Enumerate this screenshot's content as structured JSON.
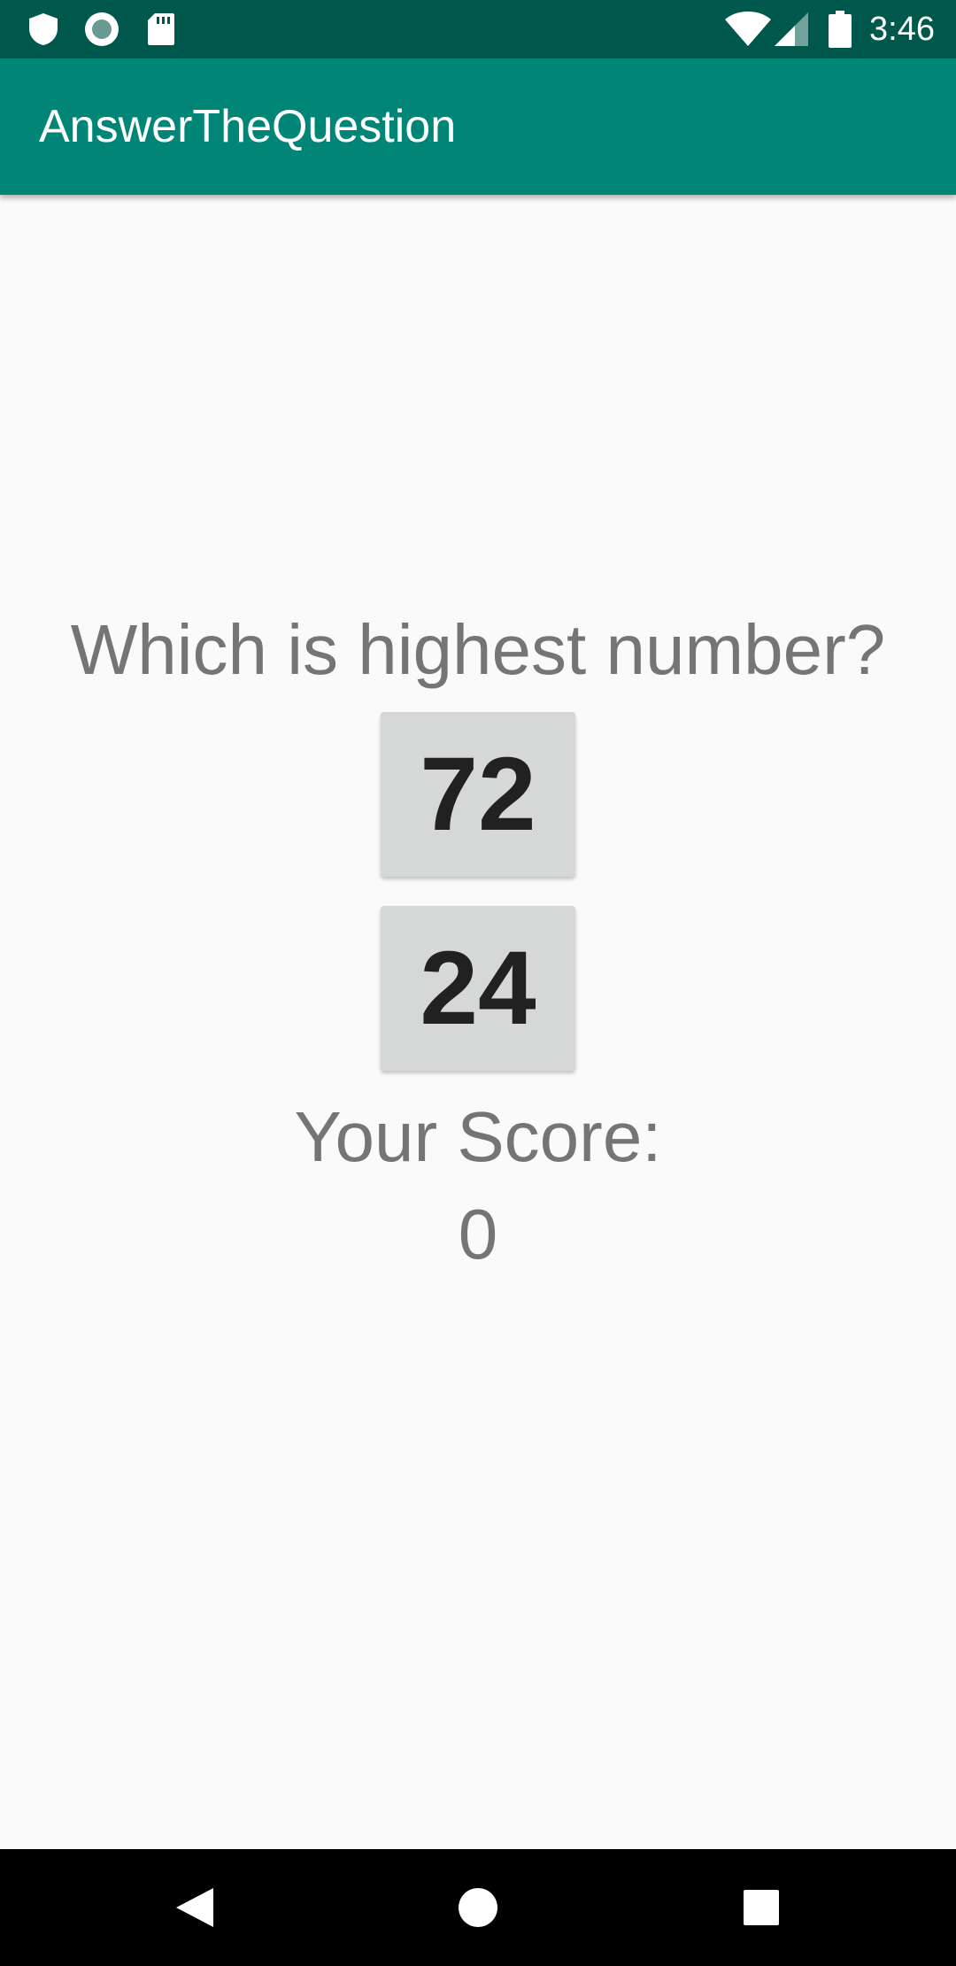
{
  "status_bar": {
    "time": "3:46",
    "left_icons": [
      "shield-icon",
      "circle-icon",
      "sd-card-icon"
    ],
    "right_icons": [
      "wifi-icon",
      "signal-icon",
      "battery-icon"
    ]
  },
  "app_bar": {
    "title": "AnswerTheQuestion"
  },
  "main": {
    "question": "Which is highest number?",
    "option_1": "72",
    "option_2": "24",
    "score_label": "Your Score:",
    "score_value": "0"
  },
  "nav_bar": {
    "buttons": [
      "back-icon",
      "home-icon",
      "recents-icon"
    ]
  },
  "colors": {
    "status_bar": "#00574b",
    "app_bar": "#008577",
    "background": "#fafafa",
    "button": "#d6d7d7",
    "text_gray": "#757575"
  }
}
